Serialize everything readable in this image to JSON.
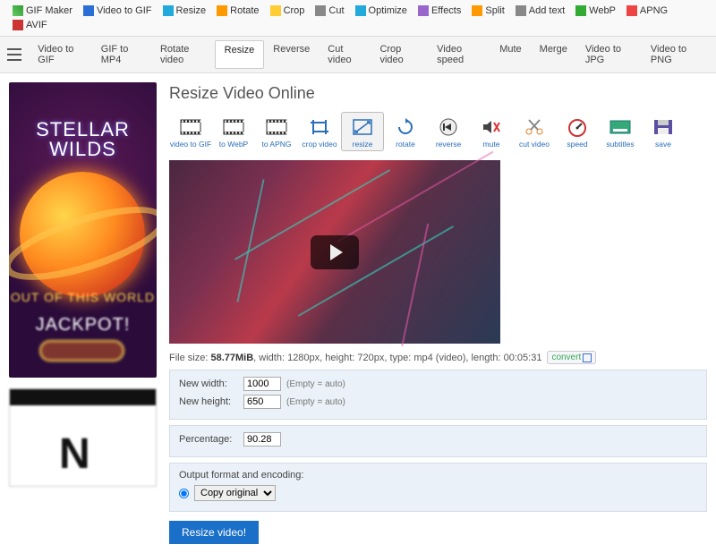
{
  "topbar": [
    {
      "label": "GIF Maker",
      "icon": "sq-g"
    },
    {
      "label": "Video to GIF",
      "icon": "sq-b"
    },
    {
      "label": "Resize",
      "icon": "sq-c"
    },
    {
      "label": "Rotate",
      "icon": "sq-o"
    },
    {
      "label": "Crop",
      "icon": "sq-y"
    },
    {
      "label": "Cut",
      "icon": "sq-gr"
    },
    {
      "label": "Optimize",
      "icon": "sq-c"
    },
    {
      "label": "Effects",
      "icon": "sq-p"
    },
    {
      "label": "Split",
      "icon": "sq-o"
    },
    {
      "label": "Add text",
      "icon": "sq-gr"
    },
    {
      "label": "WebP",
      "icon": "sq-gn"
    },
    {
      "label": "APNG",
      "icon": "sq-r"
    },
    {
      "label": "AVIF",
      "icon": "sq-av"
    }
  ],
  "subbar": [
    "Video to GIF",
    "GIF to MP4",
    "Rotate video",
    "Resize",
    "Reverse",
    "Cut video",
    "Crop video",
    "Video speed",
    "Mute",
    "Merge",
    "Video to JPG",
    "Video to PNG"
  ],
  "subbar_active_index": 3,
  "page": {
    "title": "Resize Video Online"
  },
  "tools": [
    {
      "name": "video-to-gif",
      "label": "video to GIF"
    },
    {
      "name": "to-webp",
      "label": "to WebP"
    },
    {
      "name": "to-apng",
      "label": "to APNG"
    },
    {
      "name": "crop-video",
      "label": "crop video"
    },
    {
      "name": "resize",
      "label": "resize",
      "active": true
    },
    {
      "name": "rotate",
      "label": "rotate"
    },
    {
      "name": "reverse",
      "label": "reverse"
    },
    {
      "name": "mute",
      "label": "mute"
    },
    {
      "name": "cut-video",
      "label": "cut video"
    },
    {
      "name": "speed",
      "label": "speed"
    },
    {
      "name": "subtitles",
      "label": "subtitles"
    },
    {
      "name": "save",
      "label": "save"
    }
  ],
  "file": {
    "meta_prefix": "File size: ",
    "size": "58.77MiB",
    "rest": ", width: 1280px, height: 720px, type: mp4 (video), length: 00:05:31",
    "convert_label": "convert"
  },
  "form": {
    "width_label": "New width:",
    "width_value": "1000",
    "height_label": "New height:",
    "height_value": "650",
    "empty_hint": "(Empty = auto)",
    "percentage_label": "Percentage:",
    "percentage_value": "90.28",
    "output_label": "Output format and encoding:",
    "output_option": "Copy original",
    "submit": "Resize video!"
  },
  "ad1": {
    "title1": "STELLAR",
    "title2": "WILDS",
    "sub1": "OUT OF THIS WORLD",
    "sub2": "JACKPOT!"
  }
}
